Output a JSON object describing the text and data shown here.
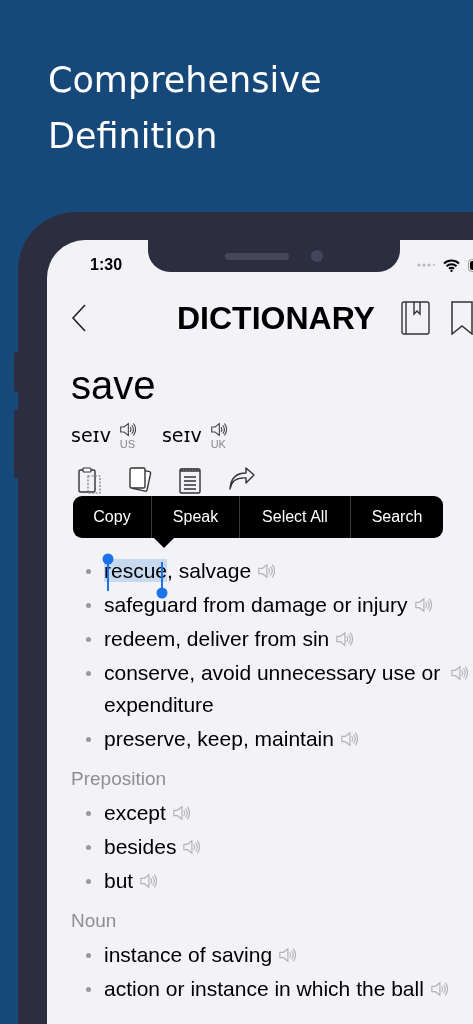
{
  "headline": "Comprehensive Definition",
  "status_bar": {
    "time": "1:30"
  },
  "nav": {
    "title": "DICTIONARY"
  },
  "word": "save",
  "pronunciations": [
    {
      "ipa": "seɪv",
      "region": "US"
    },
    {
      "ipa": "seɪv",
      "region": "UK"
    }
  ],
  "context_menu": [
    "Copy",
    "Speak",
    "Select All",
    "Search"
  ],
  "sections": [
    {
      "items": [
        {
          "parts": [
            {
              "text": "rescue",
              "selected": true
            },
            {
              "text": ", salvage",
              "selected": false
            }
          ]
        },
        {
          "text": "safeguard from damage or injury"
        },
        {
          "text": "redeem, deliver from sin"
        },
        {
          "text": "conserve, avoid unnecessary use or expenditure"
        },
        {
          "text": "preserve, keep, maintain"
        }
      ]
    },
    {
      "label": "Preposition",
      "items": [
        {
          "text": "except"
        },
        {
          "text": "besides"
        },
        {
          "text": "but"
        }
      ]
    },
    {
      "label": "Noun",
      "items": [
        {
          "text": "instance of saving"
        },
        {
          "text": "action or instance in which the ball"
        }
      ]
    }
  ]
}
